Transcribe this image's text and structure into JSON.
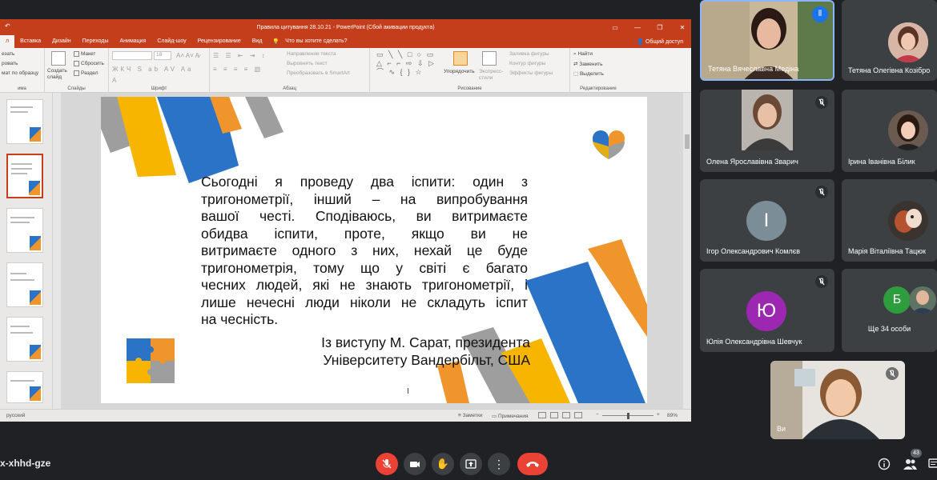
{
  "ppt": {
    "window_title": "Правила цитування 28.10.21 - PowerPoint (Сбой акивации продукта)",
    "tabs": [
      "л",
      "Вставка",
      "Дизайн",
      "Переходы",
      "Анимация",
      "Слайд-шоу",
      "Рецензирование",
      "Вид"
    ],
    "tell_me": "Что вы хотите сделать?",
    "share": "Общий доступ",
    "ribbon": {
      "clipboard_items": [
        "езать",
        "ровать",
        "мат по образцу"
      ],
      "clipboard_group": "има",
      "new_slide": "Создать слайд",
      "slide_items": [
        "Макет",
        "Сбросить",
        "Раздел"
      ],
      "slides_group": "Слайды",
      "font_size": "18",
      "font_group": "Шрифт",
      "paragraph_items": [
        "Направление текста",
        "Выровнять текст",
        "Преобразовать в SmartArt"
      ],
      "paragraph_group": "Абзац",
      "arrange": "Упорядочить",
      "quick_styles": "Экспресс-стили",
      "drawing_items": [
        "Заливка фигуры",
        "Контур фигуры",
        "Эффекты фигуры"
      ],
      "drawing_group": "Рисование",
      "editing_items": [
        "Найти",
        "Заменить",
        "Выделить"
      ],
      "editing_group": "Редактирование"
    },
    "status": {
      "language": "русский",
      "notes": "Заметки",
      "comments": "Примечания",
      "zoom": "89%"
    }
  },
  "slide": {
    "quote_lines": [
      "Сьогодні я проведу два іспити: один з",
      "тригонометрії, інший – на випробування",
      "вашої честі. Сподіваюсь, ви витримаєте",
      "обидва іспити, проте, якщо ви не",
      "витримаєте одного з них, нехай це буде",
      "тригонометрія, тому що у світі є багато",
      "чесних людей, які не знають тригонометрії, і",
      "лише нечесні люди ніколи не складуть іспит",
      "на чесність."
    ],
    "attribution_lines": [
      "Із виступу М. Сарат, президента",
      "Університету Вандербільт, США"
    ]
  },
  "participants": [
    {
      "name": "Тетяна Вячеславна Медіна"
    },
    {
      "name": "Тетяна Олегівна Козібро"
    },
    {
      "name": "Олена Ярославівна Зварич"
    },
    {
      "name": "Ірина Іванівна Білик"
    },
    {
      "name": "Ігор Олександрович Комлєв",
      "initial": "І"
    },
    {
      "name": "Марія Віталіївна Тацюк"
    },
    {
      "name": "Юлія Олександрівна Шевчук",
      "initial": "Ю"
    },
    {
      "name": "Ще 34 особи",
      "initial": "Б"
    },
    {
      "name": "Ви"
    }
  ],
  "meeting": {
    "code": "x-xhhd-gze",
    "participant_count": "43"
  },
  "colors": {
    "meet_bg": "#202124",
    "tile_bg": "#3c4043",
    "ppt_accent": "#c43e1c",
    "blue": "#2b73c6",
    "orange": "#f0952c",
    "yellow": "#f7b500",
    "gray": "#9e9e9e",
    "avatar_gray": "#7b8d96",
    "avatar_purple": "#9c27b0",
    "avatar_green": "#2e9d3e",
    "hangup_red": "#ea4335"
  }
}
